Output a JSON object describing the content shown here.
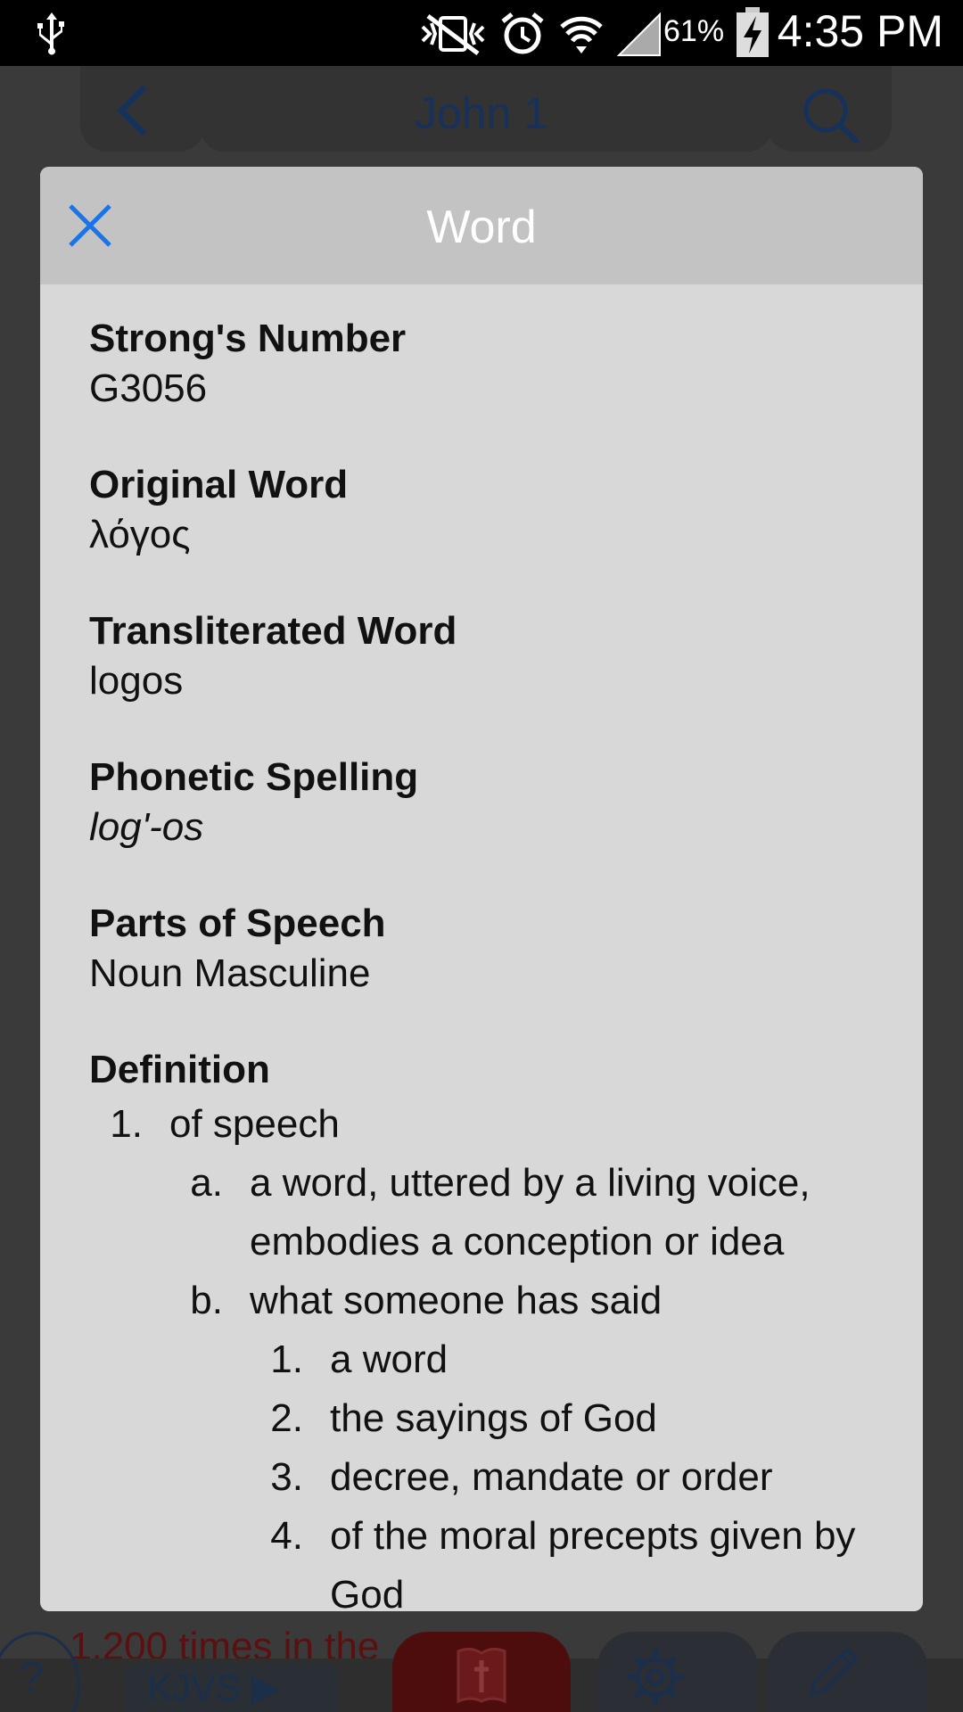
{
  "status_bar": {
    "battery_percent": "61%",
    "time": "4:35 PM",
    "icons": [
      "usb-icon",
      "mute-vibrate-icon",
      "alarm-icon",
      "wifi-icon",
      "signal-icon",
      "battery-charging-icon"
    ]
  },
  "app_header": {
    "title": "John 1",
    "back_icon": "chevron-left-icon",
    "search_icon": "search-icon"
  },
  "background": {
    "partial_text": "1,200 times in the"
  },
  "bottom_bar": {
    "help_label": "?",
    "version_label": "KJVS ▶",
    "icons": [
      "bible-icon",
      "gear-icon",
      "pencil-icon"
    ]
  },
  "dialog": {
    "title": "Word",
    "close_icon": "close-icon",
    "fields": [
      {
        "label": "Strong's Number",
        "value": "G3056",
        "italic": false
      },
      {
        "label": "Original Word",
        "value": "λόγος",
        "italic": false
      },
      {
        "label": "Transliterated Word",
        "value": "logos",
        "italic": false
      },
      {
        "label": "Phonetic Spelling",
        "value": "log'-os",
        "italic": true
      },
      {
        "label": "Parts of Speech",
        "value": "Noun Masculine",
        "italic": false
      }
    ],
    "definition": {
      "label": "Definition",
      "items": [
        {
          "level": 1,
          "marker": "1.",
          "text": "of speech"
        },
        {
          "level": 2,
          "marker": "a.",
          "text": "a word, uttered by a living voice, embodies a conception or idea"
        },
        {
          "level": 2,
          "marker": "b.",
          "text": "what someone has said"
        },
        {
          "level": 3,
          "marker": "1.",
          "text": "a word"
        },
        {
          "level": 3,
          "marker": "2.",
          "text": "the sayings of God"
        },
        {
          "level": 3,
          "marker": "3.",
          "text": "decree, mandate or order"
        },
        {
          "level": 3,
          "marker": "4.",
          "text": "of the moral precepts given by God"
        }
      ]
    }
  }
}
